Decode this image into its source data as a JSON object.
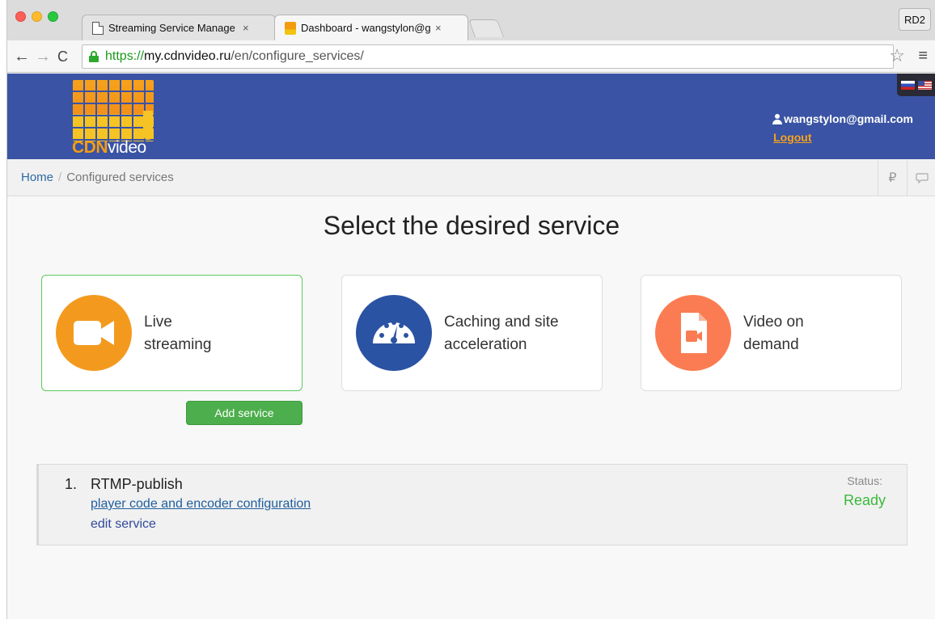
{
  "browser": {
    "tabs": [
      {
        "title": "Streaming Service Manage",
        "close": "×"
      },
      {
        "title": "Dashboard - wangstylon@g",
        "close": "×"
      }
    ],
    "profile_label": "RD2",
    "url": {
      "scheme": "https://",
      "host": "my.cdnvideo.ru",
      "path": "/en/configure_services/"
    }
  },
  "header": {
    "logo": {
      "cdn": "CDN",
      "video": "video"
    },
    "user_email": "wangstylon@gmail.com",
    "logout_label": "Logout"
  },
  "breadcrumb": {
    "home": "Home",
    "separator": "/",
    "current": "Configured services",
    "tools": {
      "ruble": "₽",
      "chat": "💬"
    }
  },
  "main": {
    "title": "Select the desired service",
    "services": [
      {
        "line1": "Live",
        "line2": "streaming",
        "icon": "video-camera-icon",
        "color": "#f39a1e",
        "selected": true
      },
      {
        "line1": "Caching and site",
        "line2": "acceleration",
        "icon": "speedometer-icon",
        "color": "#2b53a3",
        "selected": false
      },
      {
        "line1": "Video on",
        "line2": "demand",
        "icon": "video-file-icon",
        "color": "#fb7c52",
        "selected": false
      }
    ],
    "add_service_label": "Add service"
  },
  "configured": [
    {
      "number": "1.",
      "name": "RTMP-publish",
      "player_link": "player code and encoder configuration",
      "edit_link": "edit service",
      "status_label": "Status:",
      "status_value": "Ready"
    }
  ],
  "colors": {
    "header_bg": "#3a53a4",
    "accent_orange": "#f7a21b",
    "success_green": "#4cae4c"
  }
}
